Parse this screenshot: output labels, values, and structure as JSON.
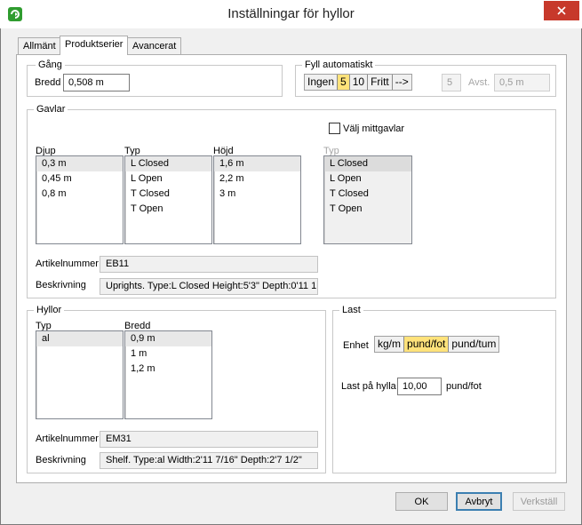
{
  "window": {
    "title": "Inställningar för hyllor"
  },
  "tabs": [
    {
      "label": "Allmänt",
      "active": false
    },
    {
      "label": "Produktserier",
      "active": true
    },
    {
      "label": "Avancerat",
      "active": false
    }
  ],
  "gang": {
    "legend": "Gång",
    "bredd_label": "Bredd",
    "bredd_value": "0,508 m"
  },
  "fyll": {
    "legend": "Fyll automatiskt",
    "options": [
      "Ingen",
      "5",
      "10",
      "Fritt",
      "-->"
    ],
    "selected": "5",
    "count_value": "5",
    "avst_label": "Avst.",
    "avst_value": "0,5 m"
  },
  "gavlar": {
    "legend": "Gavlar",
    "mittgavlar_label": "Välj mittgavlar",
    "mittgavlar_checked": false,
    "djup": {
      "header": "Djup",
      "items": [
        "0,3 m",
        "0,45 m",
        "0,8 m"
      ],
      "selected_index": 0
    },
    "typ": {
      "header": "Typ",
      "items": [
        "L Closed",
        "L Open",
        "T Closed",
        "T Open"
      ],
      "selected_index": 0
    },
    "hojd": {
      "header": "Höjd",
      "items": [
        "1,6 m",
        "2,2 m",
        "3 m"
      ],
      "selected_index": 0
    },
    "mitt_typ": {
      "header": "Typ",
      "items": [
        "L Closed",
        "L Open",
        "T Closed",
        "T Open"
      ],
      "selected_index": 0
    },
    "artikelnummer_label": "Artikelnummer",
    "artikelnummer_value": "EB11",
    "beskrivning_label": "Beskrivning",
    "beskrivning_value": "Uprights. Type:L Closed Height:5'3\" Depth:0'11 1"
  },
  "hyllor": {
    "legend": "Hyllor",
    "typ": {
      "header": "Typ",
      "items": [
        "al"
      ],
      "selected_index": 0
    },
    "bredd": {
      "header": "Bredd",
      "items": [
        "0,9 m",
        "1 m",
        "1,2 m"
      ],
      "selected_index": 0
    },
    "artikelnummer_label": "Artikelnummer",
    "artikelnummer_value": "EM31",
    "beskrivning_label": "Beskrivning",
    "beskrivning_value": "Shelf. Type:al Width:2'11 7/16\" Depth:2'7 1/2\""
  },
  "last": {
    "legend": "Last",
    "enhet_label": "Enhet",
    "units": [
      "kg/m",
      "pund/fot",
      "pund/tum"
    ],
    "selected_unit": "pund/fot",
    "last_label": "Last på hylla",
    "last_value": "10,00",
    "last_unit": "pund/fot"
  },
  "buttons": {
    "ok": "OK",
    "cancel": "Avbryt",
    "apply": "Verkställ"
  },
  "colors": {
    "selection_yellow": "#ffe27a",
    "close_red": "#c7392b",
    "focus_blue": "#3c7fb1"
  }
}
